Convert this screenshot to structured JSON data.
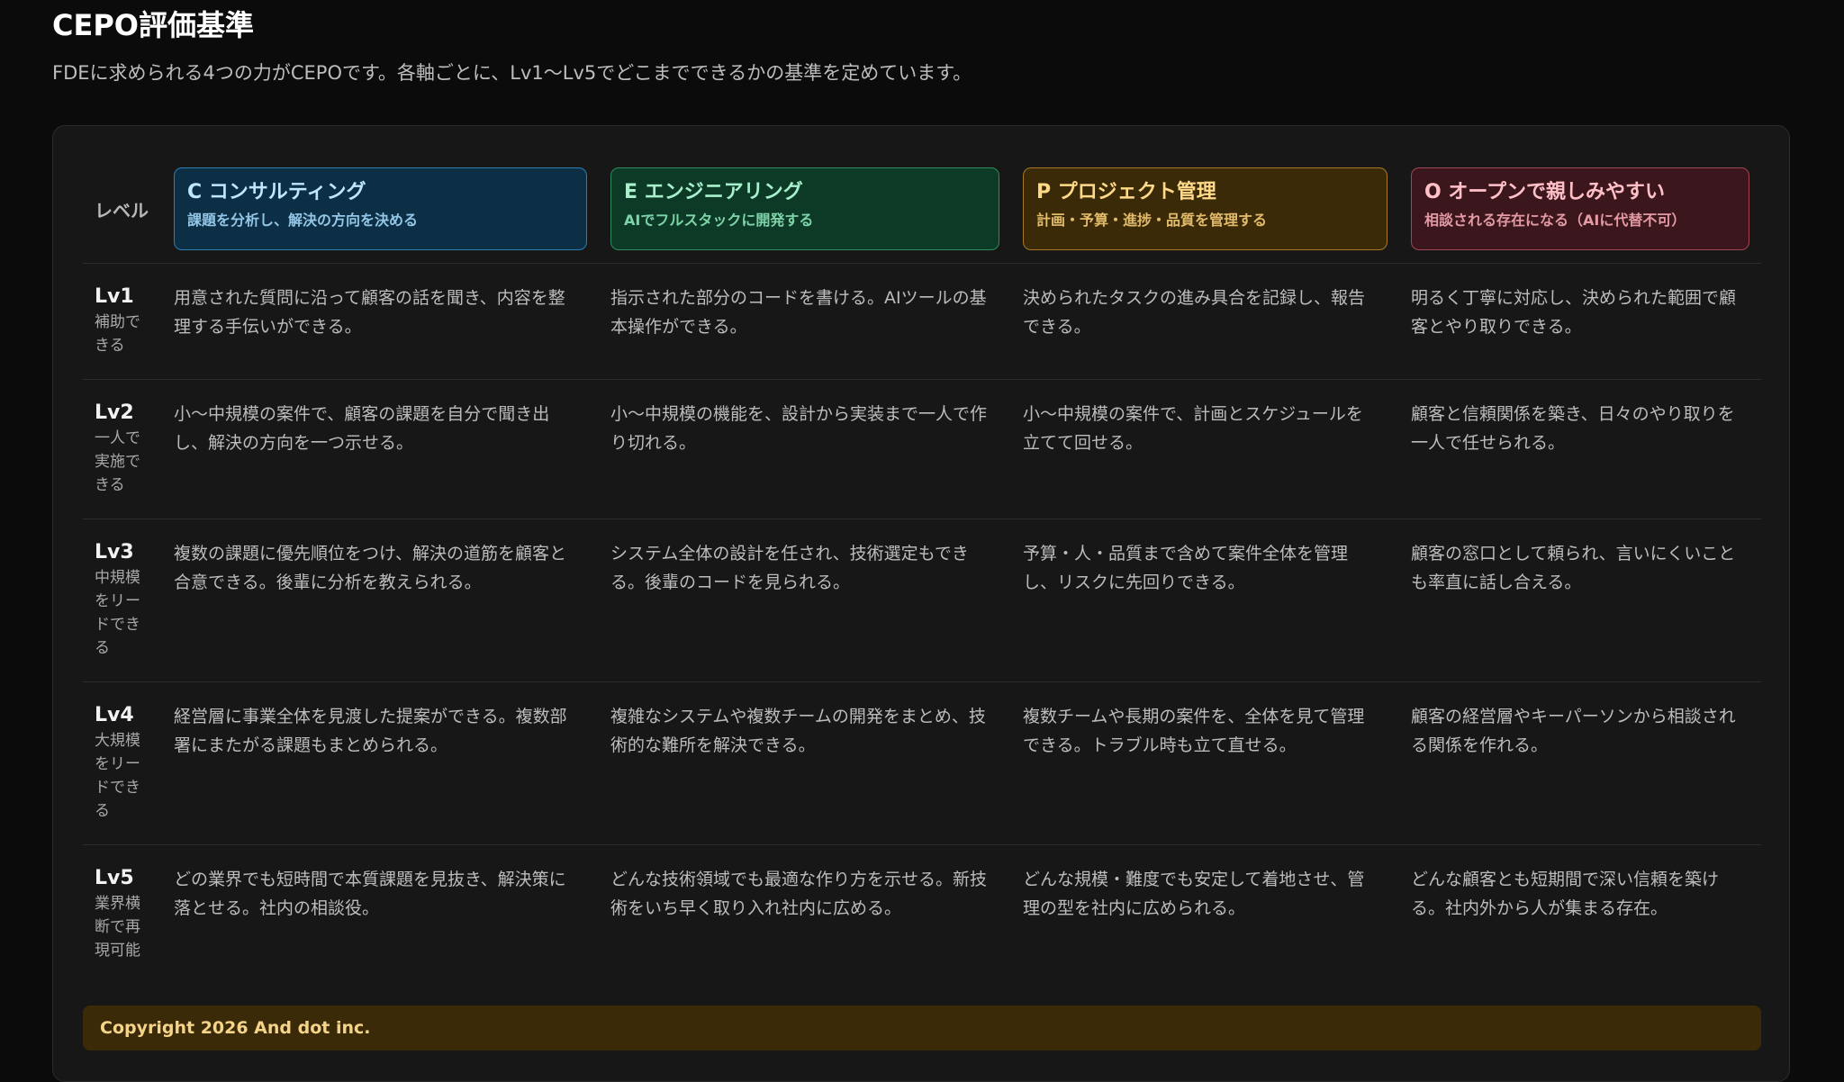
{
  "page": {
    "title": "CEPO評価基準",
    "subtitle": "FDEに求められる4つの力がCEPOです。各軸ごとに、Lv1〜Lv5でどこまでできるかの基準を定めています。"
  },
  "table": {
    "level_header": "レベル",
    "axes": [
      {
        "title": "C コンサルティング",
        "desc": "課題を分析し、解決の方向を決める",
        "color": "#2b7fb1"
      },
      {
        "title": "E エンジニアリング",
        "desc": "AIでフルスタックに開発する",
        "color": "#2f8c5e"
      },
      {
        "title": "P プロジェクト管理",
        "desc": "計画・予算・進捗・品質を管理する",
        "color": "#a8781e"
      },
      {
        "title": "O オープンで親しみやすい",
        "desc": "相談される存在になる（AIに代替不可）",
        "color": "#a04754"
      }
    ],
    "levels": [
      {
        "name": "Lv1",
        "note": "補助できる",
        "cells": [
          "用意された質問に沿って顧客の話を聞き、内容を整理する手伝いができる。",
          "指示された部分のコードを書ける。AIツールの基本操作ができる。",
          "決められたタスクの進み具合を記録し、報告できる。",
          "明るく丁寧に対応し、決められた範囲で顧客とやり取りできる。"
        ]
      },
      {
        "name": "Lv2",
        "note": "一人で実施できる",
        "cells": [
          "小〜中規模の案件で、顧客の課題を自分で聞き出し、解決の方向を一つ示せる。",
          "小〜中規模の機能を、設計から実装まで一人で作り切れる。",
          "小〜中規模の案件で、計画とスケジュールを立てて回せる。",
          "顧客と信頼関係を築き、日々のやり取りを一人で任せられる。"
        ]
      },
      {
        "name": "Lv3",
        "note": "中規模をリードできる",
        "cells": [
          "複数の課題に優先順位をつけ、解決の道筋を顧客と合意できる。後輩に分析を教えられる。",
          "システム全体の設計を任され、技術選定もできる。後輩のコードを見られる。",
          "予算・人・品質まで含めて案件全体を管理し、リスクに先回りできる。",
          "顧客の窓口として頼られ、言いにくいことも率直に話し合える。"
        ]
      },
      {
        "name": "Lv4",
        "note": "大規模をリードできる",
        "cells": [
          "経営層に事業全体を見渡した提案ができる。複数部署にまたがる課題もまとめられる。",
          "複雑なシステムや複数チームの開発をまとめ、技術的な難所を解決できる。",
          "複数チームや長期の案件を、全体を見て管理できる。トラブル時も立て直せる。",
          "顧客の経営層やキーパーソンから相談される関係を作れる。"
        ]
      },
      {
        "name": "Lv5",
        "note": "業界横断で再現可能",
        "cells": [
          "どの業界でも短時間で本質課題を見抜き、解決策に落とせる。社内の相談役。",
          "どんな技術領域でも最適な作り方を示せる。新技術をいち早く取り入れ社内に広める。",
          "どんな規模・難度でも安定して着地させ、管理の型を社内に広められる。",
          "どんな顧客とも短期間で深い信頼を築ける。社内外から人が集まる存在。"
        ]
      }
    ]
  },
  "footer": {
    "copyright": "Copyright 2026 And dot inc."
  }
}
